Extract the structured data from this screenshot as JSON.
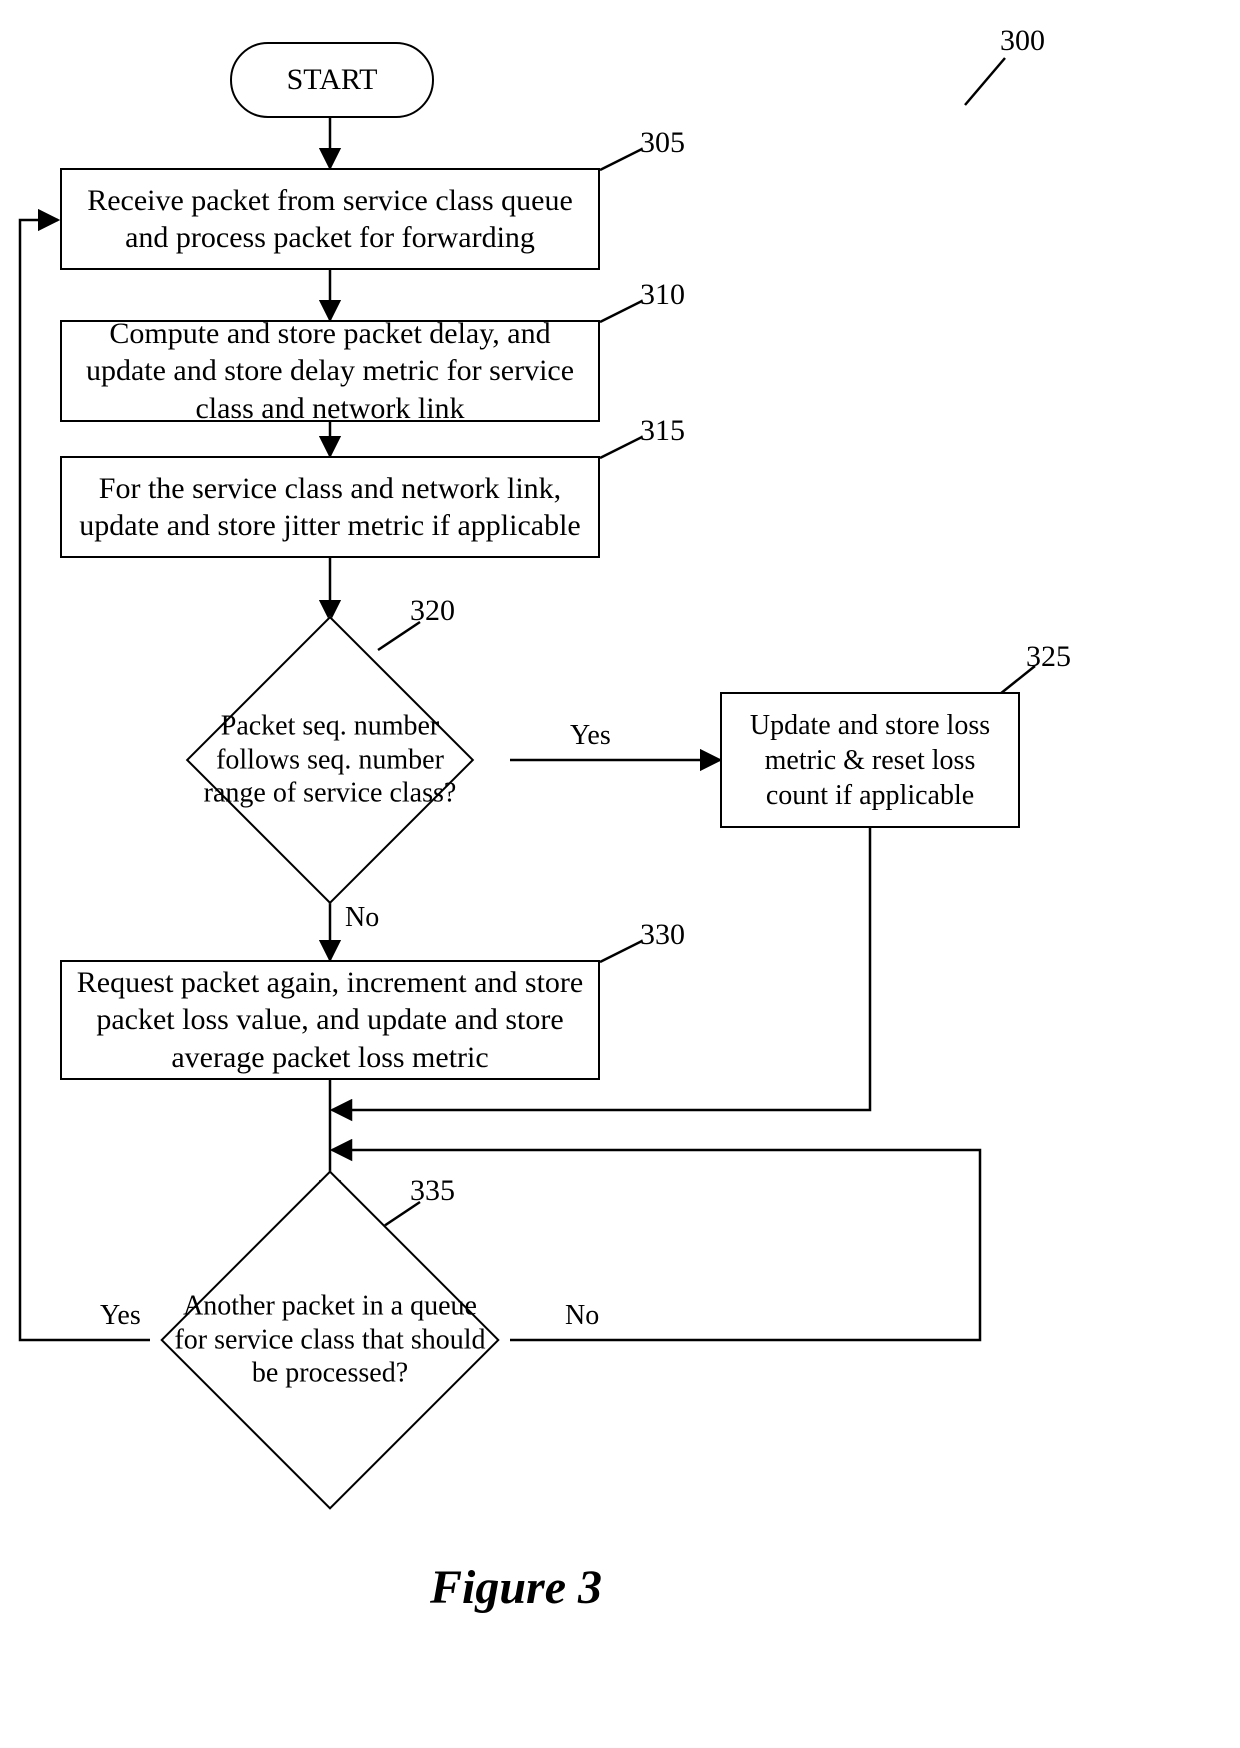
{
  "nodes": {
    "start": "START",
    "n305": "Receive packet from service class queue and process packet for forwarding",
    "n310": "Compute and store packet delay, and update and store delay metric for service class and network link",
    "n315": "For the service class and network link, update and store jitter metric if applicable",
    "n320": "Packet seq. number follows seq. number range of service class?",
    "n325": "Update and store loss metric & reset loss count if applicable",
    "n330": "Request packet again, increment and store packet loss value, and update and store average packet loss metric",
    "n335": "Another packet in a queue for service class that should be processed?"
  },
  "edge_labels": {
    "yes320": "Yes",
    "no320": "No",
    "yes335": "Yes",
    "no335": "No"
  },
  "refs": {
    "fig": "300",
    "r305": "305",
    "r310": "310",
    "r315": "315",
    "r320": "320",
    "r325": "325",
    "r330": "330",
    "r335": "335"
  },
  "caption": "Figure 3"
}
